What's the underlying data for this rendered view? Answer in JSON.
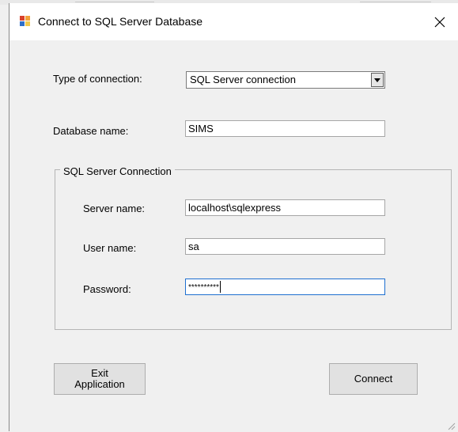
{
  "window": {
    "title": "Connect to SQL Server Database"
  },
  "icons": {
    "app": "sql-server-connection-icon",
    "close": "close-icon",
    "dropdown": "chevron-down-icon",
    "grip": "resize-grip-icon"
  },
  "form": {
    "connection_type_label": "Type of connection:",
    "connection_type_value": "SQL Server connection",
    "database_name_label": "Database name:",
    "database_name_value": "SIMS",
    "group_title": "SQL Server Connection",
    "server_name_label": "Server name:",
    "server_name_value": "localhost\\sqlexpress",
    "user_name_label": "User name:",
    "user_name_value": "sa",
    "password_label": "Password:",
    "password_value": "**********"
  },
  "buttons": {
    "exit_line1": "Exit",
    "exit_line2": "Application",
    "connect": "Connect"
  },
  "colors": {
    "window_bg": "#f0f0f0",
    "titlebar_bg": "#ffffff",
    "button_bg": "#e1e1e1",
    "input_border": "#a6a6a6"
  }
}
